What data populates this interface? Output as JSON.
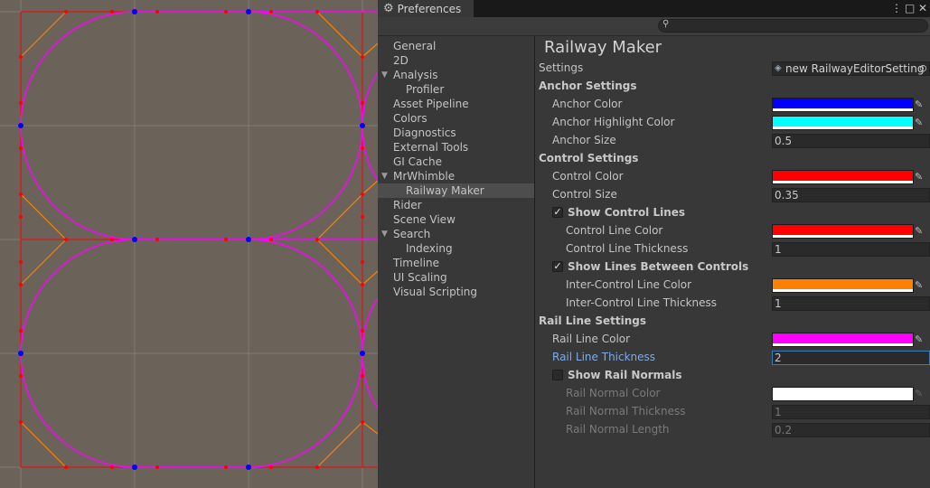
{
  "window": {
    "tab_title": "Preferences",
    "icons": {
      "tab": "gear-icon",
      "menu": "kebab-menu-icon",
      "maximize": "maximize-icon",
      "close": "close-icon"
    }
  },
  "search": {
    "value": "",
    "icon": "search-icon"
  },
  "sidebar": {
    "items": [
      {
        "label": "General",
        "indent": 0
      },
      {
        "label": "2D",
        "indent": 0
      },
      {
        "label": "Analysis",
        "indent": 0,
        "expanded": true
      },
      {
        "label": "Profiler",
        "indent": 1
      },
      {
        "label": "Asset Pipeline",
        "indent": 0
      },
      {
        "label": "Colors",
        "indent": 0
      },
      {
        "label": "Diagnostics",
        "indent": 0
      },
      {
        "label": "External Tools",
        "indent": 0
      },
      {
        "label": "GI Cache",
        "indent": 0
      },
      {
        "label": "MrWhimble",
        "indent": 0,
        "expanded": true
      },
      {
        "label": "Railway Maker",
        "indent": 1,
        "selected": true
      },
      {
        "label": "Rider",
        "indent": 0
      },
      {
        "label": "Scene View",
        "indent": 0
      },
      {
        "label": "Search",
        "indent": 0,
        "expanded": true
      },
      {
        "label": "Indexing",
        "indent": 1
      },
      {
        "label": "Timeline",
        "indent": 0
      },
      {
        "label": "UI Scaling",
        "indent": 0
      },
      {
        "label": "Visual Scripting",
        "indent": 0
      }
    ]
  },
  "main": {
    "title": "Railway Maker",
    "rows": [
      {
        "label": "Settings",
        "level": 0,
        "kind": "object",
        "value": "new RailwayEditorSetting"
      },
      {
        "label": "Anchor Settings",
        "level": 0,
        "kind": "header"
      },
      {
        "label": "Anchor Color",
        "level": 1,
        "kind": "color",
        "color": "#0000ff"
      },
      {
        "label": "Anchor Highlight Color",
        "level": 1,
        "kind": "color",
        "color": "#00ffff"
      },
      {
        "label": "Anchor Size",
        "level": 1,
        "kind": "field",
        "value": "0.5"
      },
      {
        "label": "Control Settings",
        "level": 0,
        "kind": "header"
      },
      {
        "label": "Control Color",
        "level": 1,
        "kind": "color",
        "color": "#ff0000"
      },
      {
        "label": "Control Size",
        "level": 1,
        "kind": "field",
        "value": "0.35"
      },
      {
        "label": "Show Control Lines",
        "level": 1,
        "kind": "checkbox",
        "checked": true
      },
      {
        "label": "Control Line Color",
        "level": 2,
        "kind": "color",
        "color": "#ff0000"
      },
      {
        "label": "Control Line Thickness",
        "level": 2,
        "kind": "field",
        "value": "1"
      },
      {
        "label": "Show Lines Between Controls",
        "level": 1,
        "kind": "checkbox",
        "checked": true
      },
      {
        "label": "Inter-Control Line Color",
        "level": 2,
        "kind": "color",
        "color": "#ff8000"
      },
      {
        "label": "Inter-Control Line Thickness",
        "level": 2,
        "kind": "field",
        "value": "1"
      },
      {
        "label": "Rail Line Settings",
        "level": 0,
        "kind": "header"
      },
      {
        "label": "Rail Line Color",
        "level": 1,
        "kind": "color",
        "color": "#ff00ff"
      },
      {
        "label": "Rail Line Thickness",
        "level": 1,
        "kind": "field",
        "value": "2",
        "focused": true
      },
      {
        "label": "Show Rail Normals",
        "level": 1,
        "kind": "checkbox",
        "checked": false
      },
      {
        "label": "Rail Normal Color",
        "level": 2,
        "kind": "color",
        "color": "#ffffff",
        "disabled": true
      },
      {
        "label": "Rail Normal Thickness",
        "level": 2,
        "kind": "field",
        "value": "1",
        "disabled": true
      },
      {
        "label": "Rail Normal Length",
        "level": 2,
        "kind": "field",
        "value": "0.2",
        "disabled": true
      }
    ]
  },
  "scene": {
    "colors": {
      "background": "#6b625a",
      "grid": "#837b74",
      "rail": "#ff00ff",
      "anchor": "#0000ff",
      "control": "#ff0000",
      "inter_control": "#ff8000"
    }
  }
}
